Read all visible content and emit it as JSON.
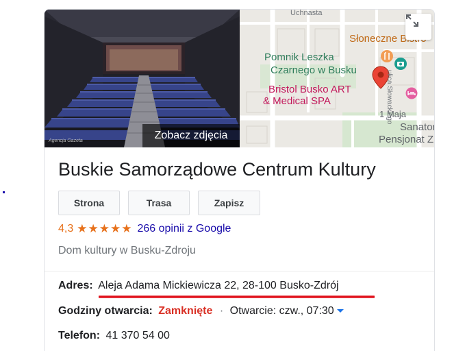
{
  "photo": {
    "label": "Zobacz zdjęcia",
    "credit": "Agencja Gazeta"
  },
  "map": {
    "labels": {
      "street_top": "Uchnasta",
      "bistro": "Słoneczne Bistro",
      "monument_line1": "Pomnik Leszka",
      "monument_line2": "Czarnego w Busku",
      "hotel_line1": "Bristol Busko ART",
      "hotel_line2": "& Medical SPA",
      "street_maja": "1 Maja",
      "sanatorium_line1": "Sanatorium &",
      "sanatorium_line2": "Pensjonat Zbyszko",
      "street_side": "ulica Słowackiego"
    },
    "icons": [
      "expand-icon",
      "map-pin-icon",
      "camera-icon",
      "restaurant-icon",
      "hotel-icon",
      "location-icon"
    ]
  },
  "place": {
    "title": "Buskie Samorządowe Centrum Kultury",
    "buttons": {
      "website": "Strona",
      "route": "Trasa",
      "save": "Zapisz"
    },
    "rating": "4,3",
    "stars": "★★★★★",
    "reviews": "266 opinii z Google",
    "category": "Dom kultury w Busku-Zdroju"
  },
  "details": {
    "address_label": "Adres:",
    "address_value": "Aleja Adama Mickiewicza 22, 28-100 Busko-Zdrój",
    "hours_label": "Godziny otwarcia:",
    "hours_status": "Zamknięte",
    "hours_separator": "·",
    "hours_next": "Otwarcie: czw., 07:30",
    "phone_label": "Telefon:",
    "phone_value": "41 370 54 00"
  },
  "colors": {
    "accent_red": "#d93025",
    "star_orange": "#e7711b",
    "link_blue": "#1a0dab",
    "annotation_red": "#e0111b"
  }
}
